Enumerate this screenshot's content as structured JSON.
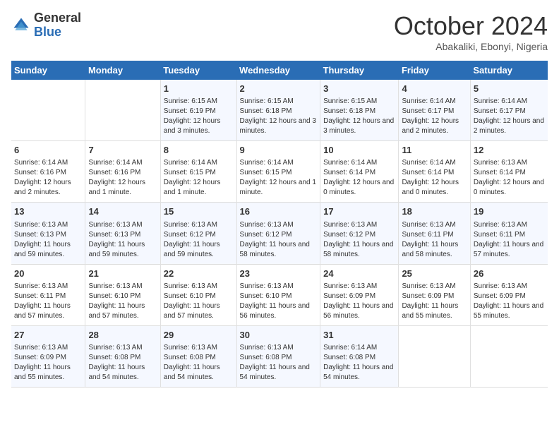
{
  "logo": {
    "general": "General",
    "blue": "Blue"
  },
  "header": {
    "month": "October 2024",
    "location": "Abakaliki, Ebonyi, Nigeria"
  },
  "days_of_week": [
    "Sunday",
    "Monday",
    "Tuesday",
    "Wednesday",
    "Thursday",
    "Friday",
    "Saturday"
  ],
  "weeks": [
    [
      {
        "day": "",
        "info": ""
      },
      {
        "day": "",
        "info": ""
      },
      {
        "day": "1",
        "info": "Sunrise: 6:15 AM\nSunset: 6:19 PM\nDaylight: 12 hours and 3 minutes."
      },
      {
        "day": "2",
        "info": "Sunrise: 6:15 AM\nSunset: 6:18 PM\nDaylight: 12 hours and 3 minutes."
      },
      {
        "day": "3",
        "info": "Sunrise: 6:15 AM\nSunset: 6:18 PM\nDaylight: 12 hours and 3 minutes."
      },
      {
        "day": "4",
        "info": "Sunrise: 6:14 AM\nSunset: 6:17 PM\nDaylight: 12 hours and 2 minutes."
      },
      {
        "day": "5",
        "info": "Sunrise: 6:14 AM\nSunset: 6:17 PM\nDaylight: 12 hours and 2 minutes."
      }
    ],
    [
      {
        "day": "6",
        "info": "Sunrise: 6:14 AM\nSunset: 6:16 PM\nDaylight: 12 hours and 2 minutes."
      },
      {
        "day": "7",
        "info": "Sunrise: 6:14 AM\nSunset: 6:16 PM\nDaylight: 12 hours and 1 minute."
      },
      {
        "day": "8",
        "info": "Sunrise: 6:14 AM\nSunset: 6:15 PM\nDaylight: 12 hours and 1 minute."
      },
      {
        "day": "9",
        "info": "Sunrise: 6:14 AM\nSunset: 6:15 PM\nDaylight: 12 hours and 1 minute."
      },
      {
        "day": "10",
        "info": "Sunrise: 6:14 AM\nSunset: 6:14 PM\nDaylight: 12 hours and 0 minutes."
      },
      {
        "day": "11",
        "info": "Sunrise: 6:14 AM\nSunset: 6:14 PM\nDaylight: 12 hours and 0 minutes."
      },
      {
        "day": "12",
        "info": "Sunrise: 6:13 AM\nSunset: 6:14 PM\nDaylight: 12 hours and 0 minutes."
      }
    ],
    [
      {
        "day": "13",
        "info": "Sunrise: 6:13 AM\nSunset: 6:13 PM\nDaylight: 11 hours and 59 minutes."
      },
      {
        "day": "14",
        "info": "Sunrise: 6:13 AM\nSunset: 6:13 PM\nDaylight: 11 hours and 59 minutes."
      },
      {
        "day": "15",
        "info": "Sunrise: 6:13 AM\nSunset: 6:12 PM\nDaylight: 11 hours and 59 minutes."
      },
      {
        "day": "16",
        "info": "Sunrise: 6:13 AM\nSunset: 6:12 PM\nDaylight: 11 hours and 58 minutes."
      },
      {
        "day": "17",
        "info": "Sunrise: 6:13 AM\nSunset: 6:12 PM\nDaylight: 11 hours and 58 minutes."
      },
      {
        "day": "18",
        "info": "Sunrise: 6:13 AM\nSunset: 6:11 PM\nDaylight: 11 hours and 58 minutes."
      },
      {
        "day": "19",
        "info": "Sunrise: 6:13 AM\nSunset: 6:11 PM\nDaylight: 11 hours and 57 minutes."
      }
    ],
    [
      {
        "day": "20",
        "info": "Sunrise: 6:13 AM\nSunset: 6:11 PM\nDaylight: 11 hours and 57 minutes."
      },
      {
        "day": "21",
        "info": "Sunrise: 6:13 AM\nSunset: 6:10 PM\nDaylight: 11 hours and 57 minutes."
      },
      {
        "day": "22",
        "info": "Sunrise: 6:13 AM\nSunset: 6:10 PM\nDaylight: 11 hours and 57 minutes."
      },
      {
        "day": "23",
        "info": "Sunrise: 6:13 AM\nSunset: 6:10 PM\nDaylight: 11 hours and 56 minutes."
      },
      {
        "day": "24",
        "info": "Sunrise: 6:13 AM\nSunset: 6:09 PM\nDaylight: 11 hours and 56 minutes."
      },
      {
        "day": "25",
        "info": "Sunrise: 6:13 AM\nSunset: 6:09 PM\nDaylight: 11 hours and 55 minutes."
      },
      {
        "day": "26",
        "info": "Sunrise: 6:13 AM\nSunset: 6:09 PM\nDaylight: 11 hours and 55 minutes."
      }
    ],
    [
      {
        "day": "27",
        "info": "Sunrise: 6:13 AM\nSunset: 6:09 PM\nDaylight: 11 hours and 55 minutes."
      },
      {
        "day": "28",
        "info": "Sunrise: 6:13 AM\nSunset: 6:08 PM\nDaylight: 11 hours and 54 minutes."
      },
      {
        "day": "29",
        "info": "Sunrise: 6:13 AM\nSunset: 6:08 PM\nDaylight: 11 hours and 54 minutes."
      },
      {
        "day": "30",
        "info": "Sunrise: 6:13 AM\nSunset: 6:08 PM\nDaylight: 11 hours and 54 minutes."
      },
      {
        "day": "31",
        "info": "Sunrise: 6:14 AM\nSunset: 6:08 PM\nDaylight: 11 hours and 54 minutes."
      },
      {
        "day": "",
        "info": ""
      },
      {
        "day": "",
        "info": ""
      }
    ]
  ]
}
